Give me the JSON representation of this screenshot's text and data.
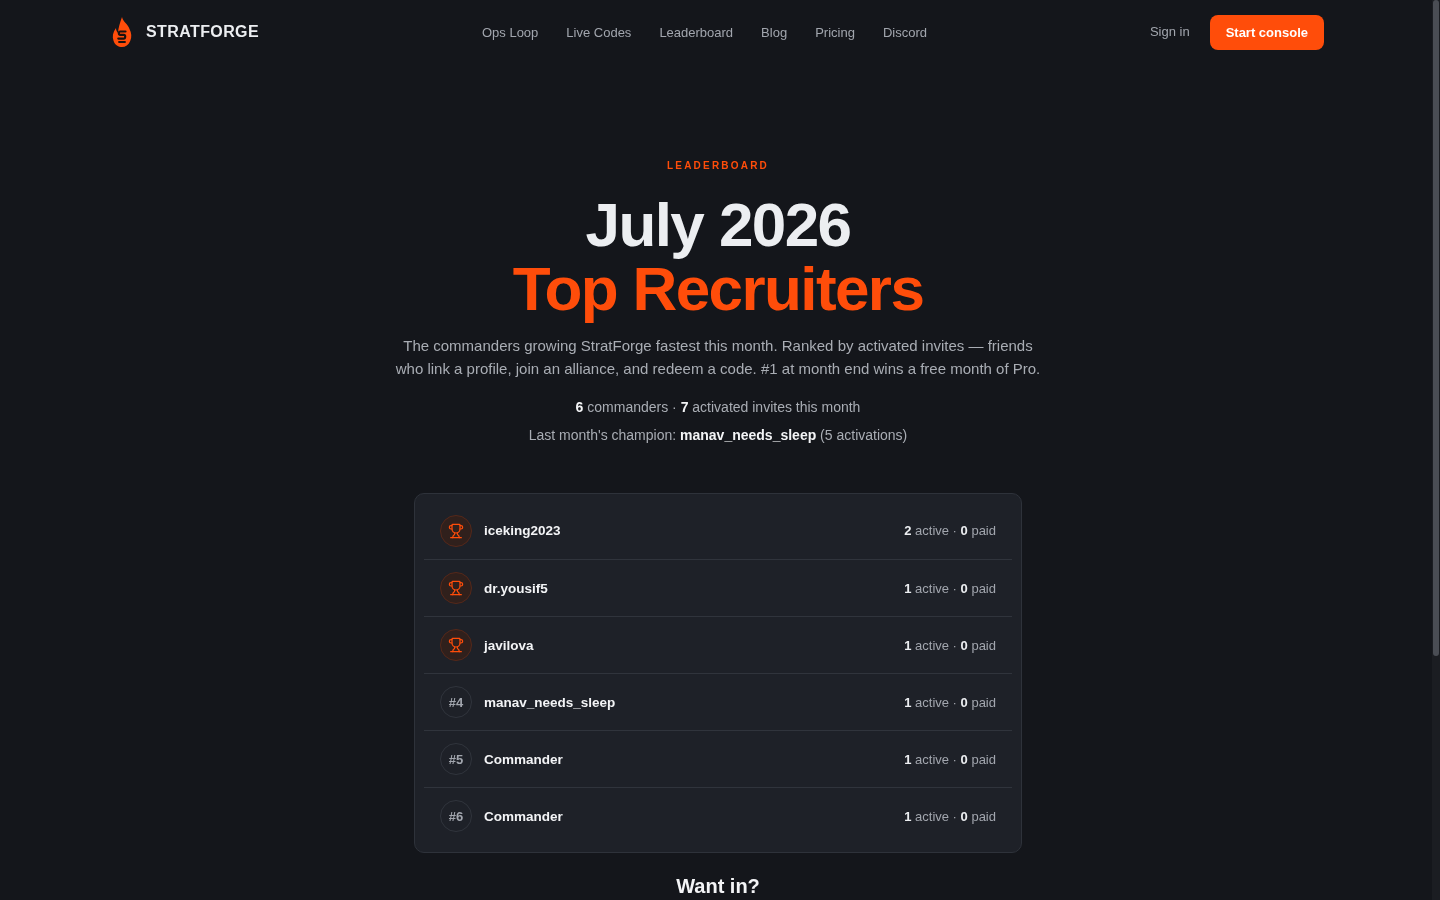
{
  "header": {
    "brand": "STRATFORGE",
    "nav": [
      {
        "label": "Ops Loop"
      },
      {
        "label": "Live Codes"
      },
      {
        "label": "Leaderboard"
      },
      {
        "label": "Blog"
      },
      {
        "label": "Pricing"
      },
      {
        "label": "Discord"
      }
    ],
    "sign_in": "Sign in",
    "cta": "Start console"
  },
  "hero": {
    "eyebrow": "LEADERBOARD",
    "title_line_1": "July 2026",
    "title_line_2": "Top Recruiters",
    "description": "The commanders growing StratForge fastest this month. Ranked by activated invites — friends who link a profile, join an alliance, and redeem a code. #1 at month end wins a free month of Pro.",
    "stats": "**6** commanders · **7** activated invites this month",
    "champion": "Last month's champion: **manav_needs_sleep** (5 activations)"
  },
  "leaderboard": [
    {
      "kind": "trophy",
      "name": "iceking2023",
      "stats": "**2** active · **0** paid"
    },
    {
      "kind": "trophy",
      "name": "dr.yousif5",
      "stats": "**1** active · **0** paid"
    },
    {
      "kind": "trophy",
      "name": "javilova",
      "stats": "**1** active · **0** paid"
    },
    {
      "kind": "rank",
      "rank": "#4",
      "name": "manav_needs_sleep",
      "stats": "**1** active · **0** paid"
    },
    {
      "kind": "rank",
      "rank": "#5",
      "name": "Commander",
      "stats": "**1** active · **0** paid"
    },
    {
      "kind": "rank",
      "rank": "#6",
      "name": "Commander",
      "stats": "**1** active · **0** paid"
    }
  ],
  "next_section": {
    "title": "Want in?"
  }
}
